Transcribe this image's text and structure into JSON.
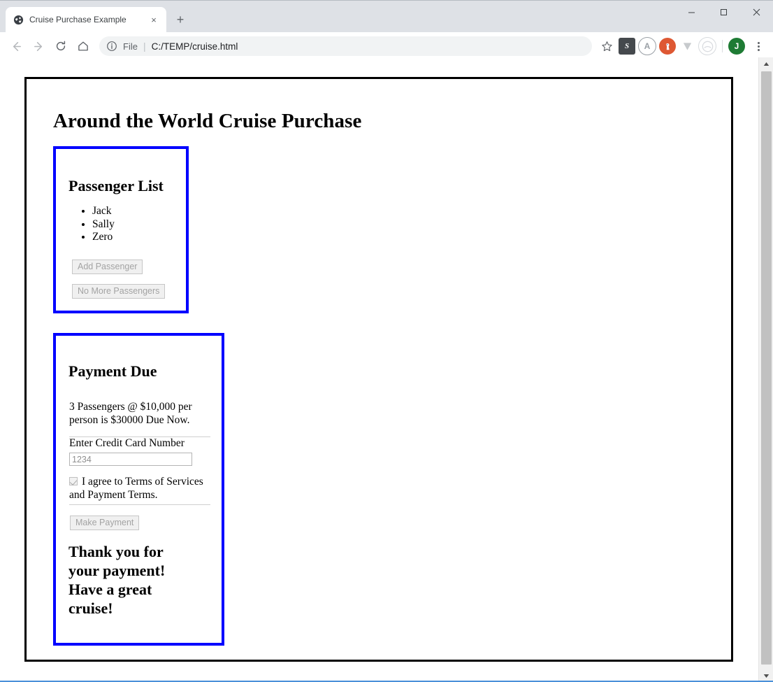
{
  "browser": {
    "tab": {
      "title": "Cruise Purchase Example",
      "favicon_name": "globe-icon",
      "close_label": "×"
    },
    "new_tab_label": "+",
    "window_controls": {
      "minimize": "–",
      "maximize": "☐",
      "close": "✕"
    },
    "nav": {
      "back": "←",
      "forward": "→",
      "reload": "↻",
      "home": "⌂"
    },
    "omnibox": {
      "info_icon": "ⓘ",
      "scheme_label": "File",
      "separator": "|",
      "url": "C:/TEMP/cruise.html",
      "bookmark_star": "☆"
    },
    "extensions": [
      {
        "name": "s-extension-icon",
        "glyph": "S"
      },
      {
        "name": "a-extension-icon",
        "glyph": "A"
      },
      {
        "name": "duckduckgo-extension-icon",
        "glyph": "⚑"
      },
      {
        "name": "v-extension-icon",
        "glyph": "V"
      },
      {
        "name": "gray-circle-extension-icon",
        "glyph": "◔"
      }
    ],
    "profile_avatar": "J",
    "menu_name": "chrome-menu-icon"
  },
  "page": {
    "title": "Around the World Cruise Purchase",
    "passenger_panel": {
      "heading": "Passenger List",
      "passengers": [
        "Jack",
        "Sally",
        "Zero"
      ],
      "add_passenger_label": "Add Passenger",
      "no_more_passengers_label": "No More Passengers"
    },
    "payment_panel": {
      "heading": "Payment Due",
      "due_text": "3 Passengers @ $10,000 per person is $30000 Due Now.",
      "credit_card_label": "Enter Credit Card Number",
      "credit_card_value": "1234",
      "credit_card_placeholder": "",
      "agree_text": "I agree to Terms of Services and Payment Terms.",
      "make_payment_label": "Make Payment",
      "thank_you_text": "Thank you for your payment! Have a great cruise!"
    }
  },
  "scrollbar": {
    "up_arrow": "▲",
    "down_arrow": "▼"
  },
  "colors": {
    "panel_border": "#0000ff",
    "page_border": "#000000",
    "avatar_green": "#1e7b34"
  }
}
